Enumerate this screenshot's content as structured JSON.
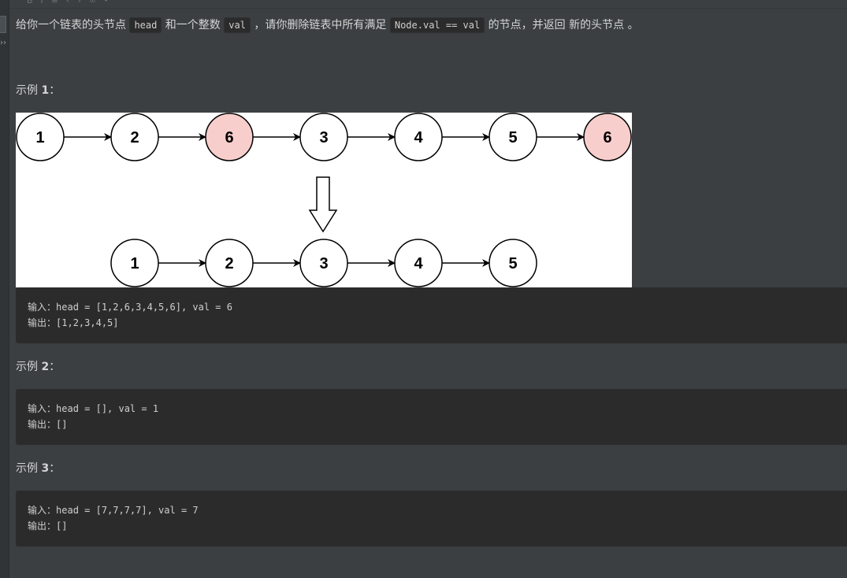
{
  "problem": {
    "desc_parts": [
      "给你一个链表的头节点 ",
      "head",
      " 和一个整数 ",
      "val",
      " ，请你删除链表中所有满足 ",
      "Node.val == val",
      " 的节点，并返回 新的头节点 。"
    ]
  },
  "examples": [
    {
      "title_prefix": "示例 ",
      "number": "1",
      "title_suffix": "：",
      "input_label": "输入：",
      "input_value": "head = [1,2,6,3,4,5,6], val = 6",
      "output_label": "输出：",
      "output_value": "[1,2,3,4,5]"
    },
    {
      "title_prefix": "示例 ",
      "number": "2",
      "title_suffix": "：",
      "input_label": "输入：",
      "input_value": "head = [], val = 1",
      "output_label": "输出：",
      "output_value": "[]"
    },
    {
      "title_prefix": "示例 ",
      "number": "3",
      "title_suffix": "：",
      "input_label": "输入：",
      "input_value": "head = [7,7,7,7], val = 7",
      "output_label": "输出：",
      "output_value": "[]"
    }
  ],
  "diagram": {
    "before": [
      "1",
      "2",
      "6",
      "3",
      "4",
      "5",
      "6"
    ],
    "removed_value": "6",
    "after": [
      "1",
      "2",
      "3",
      "4",
      "5"
    ],
    "colors": {
      "normal_fill": "#ffffff",
      "removed_fill": "#f8cecc",
      "stroke": "#000000"
    }
  },
  "gutter": {
    "arrow_glyph": "››"
  }
}
